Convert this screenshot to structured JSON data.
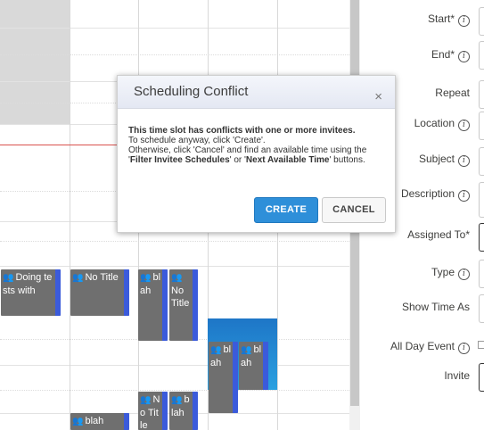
{
  "calendar": {
    "events": [
      {
        "id": "e1",
        "text": "Doing tests with"
      },
      {
        "id": "e2",
        "text": "No Title"
      },
      {
        "id": "e3",
        "text": "blah"
      },
      {
        "id": "e4",
        "text": "No Title"
      },
      {
        "id": "e5",
        "text": "blah"
      },
      {
        "id": "e6",
        "text": "blah"
      },
      {
        "id": "e7",
        "text": "No Title"
      },
      {
        "id": "e8",
        "text": "blah"
      },
      {
        "id": "e9",
        "text": "blah"
      }
    ]
  },
  "form": {
    "start_label": "Start",
    "end_label": "End",
    "repeat_label": "Repeat",
    "location_label": "Location",
    "subject_label": "Subject",
    "description_label": "Description",
    "assigned_to_label": "Assigned To",
    "type_label": "Type",
    "show_time_as_label": "Show Time As",
    "all_day_event_label": "All Day Event",
    "invite_label": "Invite",
    "required_mark": "*",
    "info_glyph": "i"
  },
  "modal": {
    "title": "Scheduling Conflict",
    "close_glyph": "×",
    "line1": "This time slot has conflicts with one or more invitees.",
    "line2": "To schedule anyway, click 'Create'.",
    "line3_prefix": "Otherwise, click 'Cancel' and find an available time using the",
    "quote_open": "'",
    "filter_btn_name": "Filter Invitee Schedules",
    "or_text": "' or '",
    "next_btn_name": "Next Available Time",
    "suffix": "' buttons.",
    "create_label": "CREATE",
    "cancel_label": "CANCEL"
  },
  "colors": {
    "event_gray": "#6f6f6f",
    "event_bar": "#3b5bdb",
    "primary_button": "#2e8fd9",
    "now_line": "#d9534f"
  }
}
